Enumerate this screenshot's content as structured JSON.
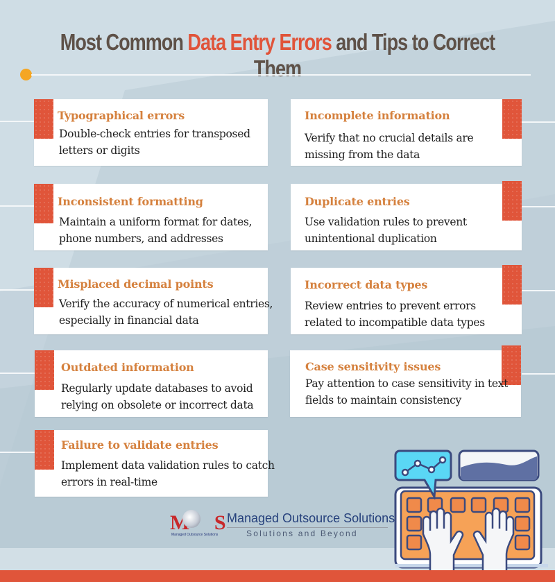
{
  "title": {
    "prefix": "Most Common ",
    "highlight": "Data Entry Errors",
    "suffix": " and Tips to Correct Them"
  },
  "colors": {
    "accent": "#e0553a",
    "heading": "#d5813e",
    "title": "#5e5148",
    "dot": "#f5a623",
    "background": "#cfdde5"
  },
  "left_cards": [
    {
      "heading": "Typographical errors",
      "body": "Double-check entries for transposed letters or digits"
    },
    {
      "heading": "Inconsistent formatting",
      "body": "Maintain a uniform format for dates, phone numbers, and addresses"
    },
    {
      "heading": "Misplaced decimal points",
      "body": "Verify the accuracy of numerical entries, especially in financial data"
    },
    {
      "heading": "Outdated information",
      "body": "Regularly update databases to avoid relying on obsolete or incorrect data"
    },
    {
      "heading": "Failure to validate entries",
      "body": "Implement data validation rules to catch errors in real-time"
    }
  ],
  "right_cards": [
    {
      "heading": "Incomplete information",
      "body": "Verify that no crucial details are missing from the data"
    },
    {
      "heading": "Duplicate entries",
      "body": "Use validation rules to prevent unintentional duplication"
    },
    {
      "heading": "Incorrect data types",
      "body": "Review entries to prevent errors related to incompatible data types"
    },
    {
      "heading": "Case sensitivity issues",
      "body": "Pay attention to case sensitivity in text fields to maintain consistency"
    }
  ],
  "logo": {
    "mark": "MOS",
    "mark_subtitle": "Managed Outsource Solutions",
    "company": "Managed Outsource Solutions",
    "tagline": "Solutions and Beyond"
  },
  "illustration": {
    "icons": [
      "line-chart-bubble-icon",
      "area-chart-panel-icon",
      "keyboard-icon",
      "hands-typing-icon"
    ]
  }
}
